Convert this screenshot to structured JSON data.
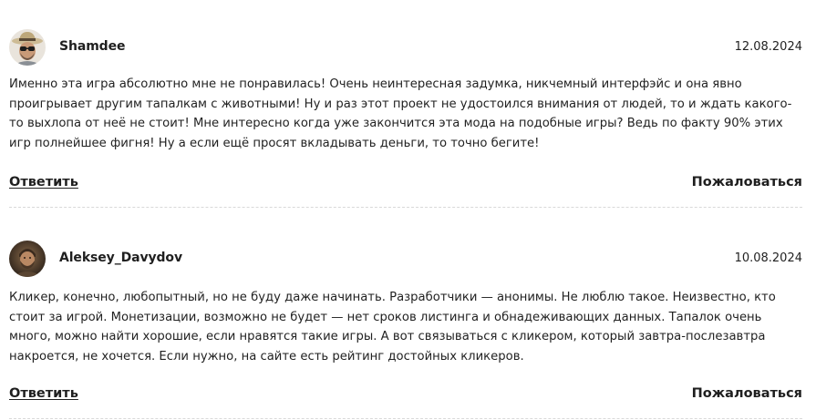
{
  "comments": [
    {
      "author": "Shamdee",
      "date": "12.08.2024",
      "avatar_icon": "user-avatar-sunglasses-hat",
      "text": "Именно эта игра абсолютно мне не понравилась! Очень неинтересная задумка, никчемный интерфэйс и она явно проигрывает другим тапалкам с животными! Ну и раз этот проект не удостоился внимания от людей, то и ждать какого-то выхлопа от неё не стоит! Мне интересно когда уже закончится эта мода на подобные игры? Ведь по факту 90% этих игр полнейшее фигня! Ну а если ещё просят вкладывать деньги, то точно бегите!",
      "reply_label": "Ответить",
      "report_label": "Пожаловаться"
    },
    {
      "author": "Aleksey_Davydov",
      "date": "10.08.2024",
      "avatar_icon": "user-avatar-photo",
      "text": "Кликер, конечно, любопытный, но не буду даже начинать. Разработчики — анонимы. Не люблю такое. Неизвестно, кто стоит за игрой. Монетизации, возможно не будет — нет сроков листинга и обнадеживающих данных. Тапалок очень много, можно найти хорошие, если нравятся такие игры. А вот связываться с кликером, который завтра-послезавтра накроется, не хочется. Если нужно, на сайте есть рейтинг достойных кликеров.",
      "reply_label": "Ответить",
      "report_label": "Пожаловаться"
    }
  ],
  "colors": {
    "text": "#222222",
    "divider": "#d9d9d9",
    "background": "#ffffff"
  }
}
